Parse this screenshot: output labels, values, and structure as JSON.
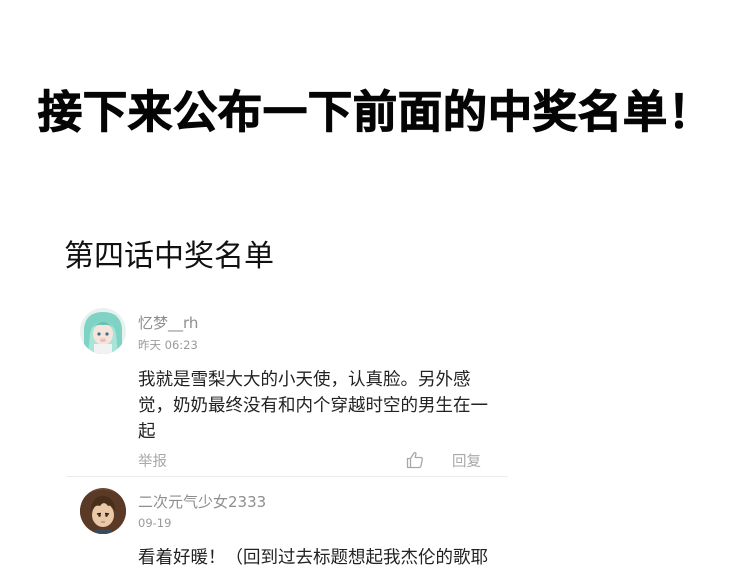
{
  "headline": "接下来公布一下前面的中奖名单！",
  "section_title": "第四话中奖名单",
  "comments": [
    {
      "username": "忆梦__rh",
      "timestamp": "昨天 06:23",
      "text": "我就是雪梨大大的小天使，认真脸。另外感觉，奶奶最终没有和内个穿越时空的男生在一起",
      "report_label": "举报",
      "reply_label": "回复",
      "like_icon": "thumbs-up-icon"
    },
    {
      "username": "二次元气少女2333",
      "timestamp": "09-19",
      "text": "看着好暖！（回到过去标题想起我杰伦的歌耶",
      "avatar": "avatar"
    }
  ]
}
